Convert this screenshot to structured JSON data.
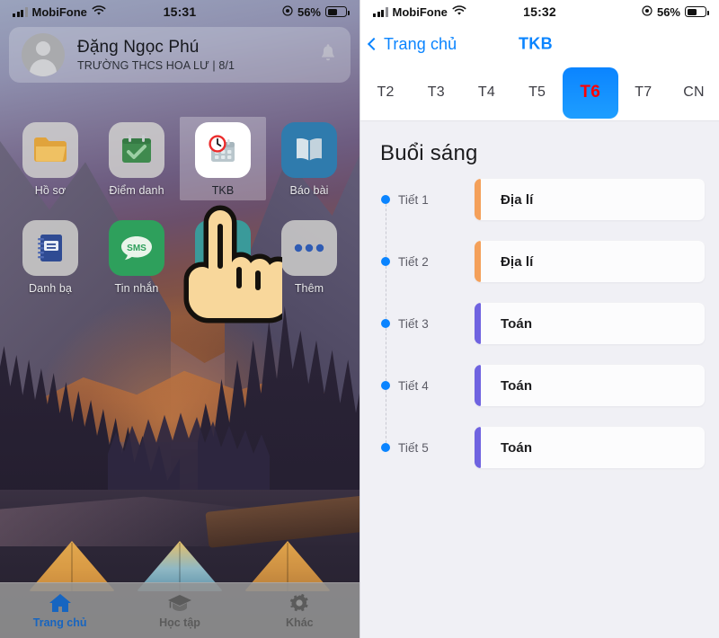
{
  "left_phone": {
    "status_bar": {
      "carrier": "MobiFone",
      "time": "15:31",
      "battery_percent": "56%",
      "signal_icon": "cellular-bars-icon",
      "wifi_icon": "wifi-icon",
      "location_icon": "location-services-icon",
      "battery_icon": "battery-icon"
    },
    "user_card": {
      "name": "Đặng Ngọc Phú",
      "subtitle": "TRƯỜNG THCS HOA LƯ | 8/1",
      "avatar_icon": "avatar-placeholder-icon",
      "bell_icon": "bell-icon"
    },
    "apps": [
      {
        "label": "Hồ sơ",
        "icon": "folder-icon",
        "tile": "ic-grey",
        "selected": false
      },
      {
        "label": "Điểm danh",
        "icon": "calendar-check-icon",
        "tile": "ic-grey",
        "selected": false
      },
      {
        "label": "TKB",
        "icon": "clock-calendar-icon",
        "tile": "ic-white",
        "selected": true
      },
      {
        "label": "Báo bài",
        "icon": "open-book-icon",
        "tile": "ic-blue",
        "selected": false
      },
      {
        "label": "Danh bạ",
        "icon": "notebook-icon",
        "tile": "ic-grey",
        "selected": false
      },
      {
        "label": "Tin nhắn",
        "icon": "sms-bubble-icon",
        "tile": "ic-green",
        "selected": false
      },
      {
        "label": "",
        "icon": "obscured-app-icon",
        "tile": "ic-teal",
        "selected": false
      },
      {
        "label": "Thêm",
        "icon": "more-dots-icon",
        "tile": "ic-grey",
        "selected": false
      }
    ],
    "cursor": {
      "icon": "pointing-hand-cursor-icon"
    },
    "tab_bar": [
      {
        "label": "Trang chủ",
        "icon": "home-icon",
        "active": true
      },
      {
        "label": "Học tập",
        "icon": "graduation-cap-icon",
        "active": false
      },
      {
        "label": "Khác",
        "icon": "gear-icon",
        "active": false
      }
    ]
  },
  "right_phone": {
    "status_bar": {
      "carrier": "MobiFone",
      "time": "15:32",
      "battery_percent": "56%"
    },
    "navbar": {
      "back_label": "Trang chủ",
      "back_icon": "chevron-left-icon",
      "title": "TKB"
    },
    "days": [
      {
        "label": "T2",
        "active": false
      },
      {
        "label": "T3",
        "active": false
      },
      {
        "label": "T4",
        "active": false
      },
      {
        "label": "T5",
        "active": false
      },
      {
        "label": "T6",
        "active": true
      },
      {
        "label": "T7",
        "active": false
      },
      {
        "label": "CN",
        "active": false
      }
    ],
    "section_title": "Buổi sáng",
    "periods": [
      {
        "period": "Tiết 1",
        "subject": "Địa lí",
        "accent": "#f4a05a"
      },
      {
        "period": "Tiết 2",
        "subject": "Địa lí",
        "accent": "#f4a05a"
      },
      {
        "period": "Tiết 3",
        "subject": "Toán",
        "accent": "#6f63e0"
      },
      {
        "period": "Tiết 4",
        "subject": "Toán",
        "accent": "#6f63e0"
      },
      {
        "period": "Tiết 5",
        "subject": "Toán",
        "accent": "#6f63e0"
      }
    ]
  },
  "colors": {
    "ios_blue": "#0a84ff",
    "selected_day_text": "#ff0000",
    "dot_blue": "#0a84ff",
    "accent_orange": "#f4a05a",
    "accent_purple": "#6f63e0",
    "page_bg": "#f0f0f5"
  }
}
